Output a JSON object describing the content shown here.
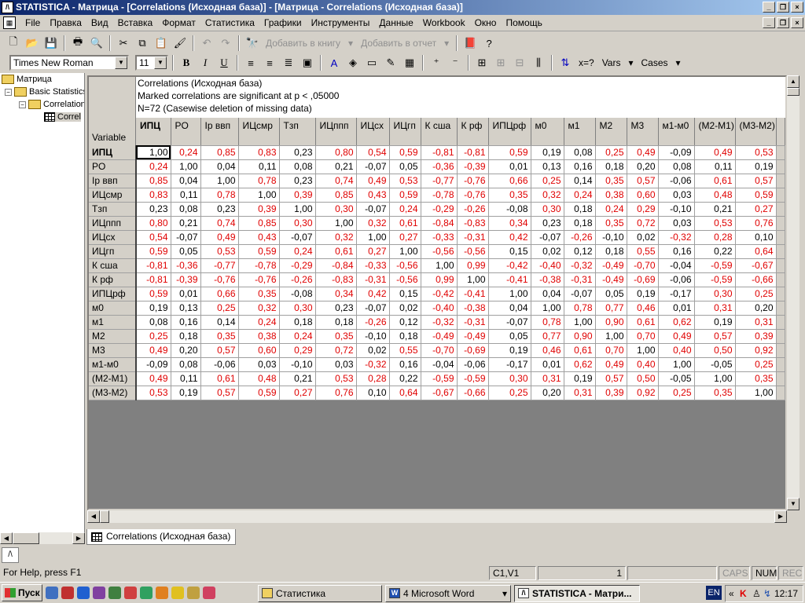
{
  "window": {
    "title": "STATISTICA - Матрица - [Correlations (Исходная база)] - [Матрица - Correlations (Исходная база)]",
    "app_icon": "statistica-icon",
    "buttons": [
      "_",
      "□",
      "×"
    ]
  },
  "menu": [
    "File",
    "Правка",
    "Вид",
    "Вставка",
    "Формат",
    "Статистика",
    "Графики",
    "Инструменты",
    "Данные",
    "Workbook",
    "Окно",
    "Помощь"
  ],
  "toolbar1": {
    "add_to_book": "Добавить в книгу",
    "add_to_report": "Добавить в отчет"
  },
  "toolbar2": {
    "font_name": "Times New Roman",
    "font_size": "11",
    "bold": "B",
    "italic": "I",
    "underline": "U",
    "xeq": "x=?",
    "vars": "Vars",
    "cases": "Cases"
  },
  "tree": {
    "root": "Матрица",
    "basic": "Basic Statistics",
    "corr": "Correlations",
    "leaf": "Correl"
  },
  "sheet": {
    "header_lines": [
      "Correlations (Исходная база)",
      "Marked correlations are significant at p < ,05000",
      "N=72 (Casewise deletion of missing data)"
    ],
    "variable_label": "Variable",
    "columns": [
      "ИПЦ",
      "PO",
      "Ip ввп",
      "ИЦсмр",
      "Тзп",
      "ИЦппп",
      "ИЦсх",
      "ИЦгп",
      "К сша",
      "К рф",
      "ИПЦрф",
      "м0",
      "м1",
      "М2",
      "М3",
      "м1-м0",
      "(М2-М1)",
      "(М3-М2)"
    ],
    "rows": [
      {
        "name": "ИПЦ",
        "values": [
          "1,00",
          "0,24",
          "0,85",
          "0,83",
          "0,23",
          "0,80",
          "0,54",
          "0,59",
          "-0,81",
          "-0,81",
          "0,59",
          "0,19",
          "0,08",
          "0,25",
          "0,49",
          "-0,09",
          "0,49",
          "0,53"
        ],
        "red": [
          0,
          1,
          1,
          1,
          0,
          1,
          1,
          1,
          1,
          1,
          1,
          0,
          0,
          1,
          1,
          0,
          1,
          1
        ]
      },
      {
        "name": "PO",
        "values": [
          "0,24",
          "1,00",
          "0,04",
          "0,11",
          "0,08",
          "0,21",
          "-0,07",
          "0,05",
          "-0,36",
          "-0,39",
          "0,01",
          "0,13",
          "0,16",
          "0,18",
          "0,20",
          "0,08",
          "0,11",
          "0,19"
        ],
        "red": [
          1,
          0,
          0,
          0,
          0,
          0,
          0,
          0,
          1,
          1,
          0,
          0,
          0,
          0,
          0,
          0,
          0,
          0
        ]
      },
      {
        "name": "Ip ввп",
        "values": [
          "0,85",
          "0,04",
          "1,00",
          "0,78",
          "0,23",
          "0,74",
          "0,49",
          "0,53",
          "-0,77",
          "-0,76",
          "0,66",
          "0,25",
          "0,14",
          "0,35",
          "0,57",
          "-0,06",
          "0,61",
          "0,57"
        ],
        "red": [
          1,
          0,
          0,
          1,
          0,
          1,
          1,
          1,
          1,
          1,
          1,
          1,
          0,
          1,
          1,
          0,
          1,
          1
        ]
      },
      {
        "name": "ИЦсмр",
        "values": [
          "0,83",
          "0,11",
          "0,78",
          "1,00",
          "0,39",
          "0,85",
          "0,43",
          "0,59",
          "-0,78",
          "-0,76",
          "0,35",
          "0,32",
          "0,24",
          "0,38",
          "0,60",
          "0,03",
          "0,48",
          "0,59"
        ],
        "red": [
          1,
          0,
          1,
          0,
          1,
          1,
          1,
          1,
          1,
          1,
          1,
          1,
          1,
          1,
          1,
          0,
          1,
          1
        ]
      },
      {
        "name": "Тзп",
        "values": [
          "0,23",
          "0,08",
          "0,23",
          "0,39",
          "1,00",
          "0,30",
          "-0,07",
          "0,24",
          "-0,29",
          "-0,26",
          "-0,08",
          "0,30",
          "0,18",
          "0,24",
          "0,29",
          "-0,10",
          "0,21",
          "0,27"
        ],
        "red": [
          0,
          0,
          0,
          1,
          0,
          1,
          0,
          1,
          1,
          1,
          0,
          1,
          0,
          1,
          1,
          0,
          0,
          1
        ]
      },
      {
        "name": "ИЦппп",
        "values": [
          "0,80",
          "0,21",
          "0,74",
          "0,85",
          "0,30",
          "1,00",
          "0,32",
          "0,61",
          "-0,84",
          "-0,83",
          "0,34",
          "0,23",
          "0,18",
          "0,35",
          "0,72",
          "0,03",
          "0,53",
          "0,76"
        ],
        "red": [
          1,
          0,
          1,
          1,
          1,
          0,
          1,
          1,
          1,
          1,
          1,
          0,
          0,
          1,
          1,
          0,
          1,
          1
        ]
      },
      {
        "name": "ИЦсх",
        "values": [
          "0,54",
          "-0,07",
          "0,49",
          "0,43",
          "-0,07",
          "0,32",
          "1,00",
          "0,27",
          "-0,33",
          "-0,31",
          "0,42",
          "-0,07",
          "-0,26",
          "-0,10",
          "0,02",
          "-0,32",
          "0,28",
          "0,10"
        ],
        "red": [
          1,
          0,
          1,
          1,
          0,
          1,
          0,
          1,
          1,
          1,
          1,
          0,
          1,
          0,
          0,
          1,
          1,
          0
        ]
      },
      {
        "name": "ИЦгп",
        "values": [
          "0,59",
          "0,05",
          "0,53",
          "0,59",
          "0,24",
          "0,61",
          "0,27",
          "1,00",
          "-0,56",
          "-0,56",
          "0,15",
          "0,02",
          "0,12",
          "0,18",
          "0,55",
          "0,16",
          "0,22",
          "0,64"
        ],
        "red": [
          1,
          0,
          1,
          1,
          1,
          1,
          1,
          0,
          1,
          1,
          0,
          0,
          0,
          0,
          1,
          0,
          0,
          1
        ]
      },
      {
        "name": "К сша",
        "values": [
          "-0,81",
          "-0,36",
          "-0,77",
          "-0,78",
          "-0,29",
          "-0,84",
          "-0,33",
          "-0,56",
          "1,00",
          "0,99",
          "-0,42",
          "-0,40",
          "-0,32",
          "-0,49",
          "-0,70",
          "-0,04",
          "-0,59",
          "-0,67"
        ],
        "red": [
          1,
          1,
          1,
          1,
          1,
          1,
          1,
          1,
          0,
          1,
          1,
          1,
          1,
          1,
          1,
          0,
          1,
          1
        ]
      },
      {
        "name": "К рф",
        "values": [
          "-0,81",
          "-0,39",
          "-0,76",
          "-0,76",
          "-0,26",
          "-0,83",
          "-0,31",
          "-0,56",
          "0,99",
          "1,00",
          "-0,41",
          "-0,38",
          "-0,31",
          "-0,49",
          "-0,69",
          "-0,06",
          "-0,59",
          "-0,66"
        ],
        "red": [
          1,
          1,
          1,
          1,
          1,
          1,
          1,
          1,
          1,
          0,
          1,
          1,
          1,
          1,
          1,
          0,
          1,
          1
        ]
      },
      {
        "name": "ИПЦрф",
        "values": [
          "0,59",
          "0,01",
          "0,66",
          "0,35",
          "-0,08",
          "0,34",
          "0,42",
          "0,15",
          "-0,42",
          "-0,41",
          "1,00",
          "0,04",
          "-0,07",
          "0,05",
          "0,19",
          "-0,17",
          "0,30",
          "0,25"
        ],
        "red": [
          1,
          0,
          1,
          1,
          0,
          1,
          1,
          0,
          1,
          1,
          0,
          0,
          0,
          0,
          0,
          0,
          1,
          1
        ]
      },
      {
        "name": "м0",
        "values": [
          "0,19",
          "0,13",
          "0,25",
          "0,32",
          "0,30",
          "0,23",
          "-0,07",
          "0,02",
          "-0,40",
          "-0,38",
          "0,04",
          "1,00",
          "0,78",
          "0,77",
          "0,46",
          "0,01",
          "0,31",
          "0,20"
        ],
        "red": [
          0,
          0,
          1,
          1,
          1,
          0,
          0,
          0,
          1,
          1,
          0,
          0,
          1,
          1,
          1,
          0,
          1,
          0
        ]
      },
      {
        "name": "м1",
        "values": [
          "0,08",
          "0,16",
          "0,14",
          "0,24",
          "0,18",
          "0,18",
          "-0,26",
          "0,12",
          "-0,32",
          "-0,31",
          "-0,07",
          "0,78",
          "1,00",
          "0,90",
          "0,61",
          "0,62",
          "0,19",
          "0,31"
        ],
        "red": [
          0,
          0,
          0,
          1,
          0,
          0,
          1,
          0,
          1,
          1,
          0,
          1,
          0,
          1,
          1,
          1,
          0,
          1
        ]
      },
      {
        "name": "М2",
        "values": [
          "0,25",
          "0,18",
          "0,35",
          "0,38",
          "0,24",
          "0,35",
          "-0,10",
          "0,18",
          "-0,49",
          "-0,49",
          "0,05",
          "0,77",
          "0,90",
          "1,00",
          "0,70",
          "0,49",
          "0,57",
          "0,39"
        ],
        "red": [
          1,
          0,
          1,
          1,
          1,
          1,
          0,
          0,
          1,
          1,
          0,
          1,
          1,
          0,
          1,
          1,
          1,
          1
        ]
      },
      {
        "name": "М3",
        "values": [
          "0,49",
          "0,20",
          "0,57",
          "0,60",
          "0,29",
          "0,72",
          "0,02",
          "0,55",
          "-0,70",
          "-0,69",
          "0,19",
          "0,46",
          "0,61",
          "0,70",
          "1,00",
          "0,40",
          "0,50",
          "0,92"
        ],
        "red": [
          1,
          0,
          1,
          1,
          1,
          1,
          0,
          1,
          1,
          1,
          0,
          1,
          1,
          1,
          0,
          1,
          1,
          1
        ]
      },
      {
        "name": "м1-м0",
        "values": [
          "-0,09",
          "0,08",
          "-0,06",
          "0,03",
          "-0,10",
          "0,03",
          "-0,32",
          "0,16",
          "-0,04",
          "-0,06",
          "-0,17",
          "0,01",
          "0,62",
          "0,49",
          "0,40",
          "1,00",
          "-0,05",
          "0,25"
        ],
        "red": [
          0,
          0,
          0,
          0,
          0,
          0,
          1,
          0,
          0,
          0,
          0,
          0,
          1,
          1,
          1,
          0,
          0,
          1
        ]
      },
      {
        "name": "(М2-М1)",
        "values": [
          "0,49",
          "0,11",
          "0,61",
          "0,48",
          "0,21",
          "0,53",
          "0,28",
          "0,22",
          "-0,59",
          "-0,59",
          "0,30",
          "0,31",
          "0,19",
          "0,57",
          "0,50",
          "-0,05",
          "1,00",
          "0,35"
        ],
        "red": [
          1,
          0,
          1,
          1,
          0,
          1,
          1,
          0,
          1,
          1,
          1,
          1,
          0,
          1,
          1,
          0,
          0,
          1
        ]
      },
      {
        "name": "(М3-М2)",
        "values": [
          "0,53",
          "0,19",
          "0,57",
          "0,59",
          "0,27",
          "0,76",
          "0,10",
          "0,64",
          "-0,67",
          "-0,66",
          "0,25",
          "0,20",
          "0,31",
          "0,39",
          "0,92",
          "0,25",
          "0,35",
          "1,00"
        ],
        "red": [
          1,
          0,
          1,
          1,
          1,
          1,
          0,
          1,
          1,
          1,
          1,
          0,
          1,
          1,
          1,
          1,
          1,
          0
        ]
      }
    ],
    "significant_color": "#e00000"
  },
  "tab": {
    "label": "Correlations (Исходная база)"
  },
  "status": {
    "help": "For Help, press F1",
    "cell": "C1,V1",
    "count": "1",
    "caps": "CAPS",
    "num": "NUM",
    "rec": "REC"
  },
  "taskbar": {
    "start": "Пуск",
    "tasks": [
      "Статистика",
      "4 Microsoft Word",
      "STATISTICA - Матри..."
    ],
    "lang": "EN",
    "clock": "12:17"
  }
}
